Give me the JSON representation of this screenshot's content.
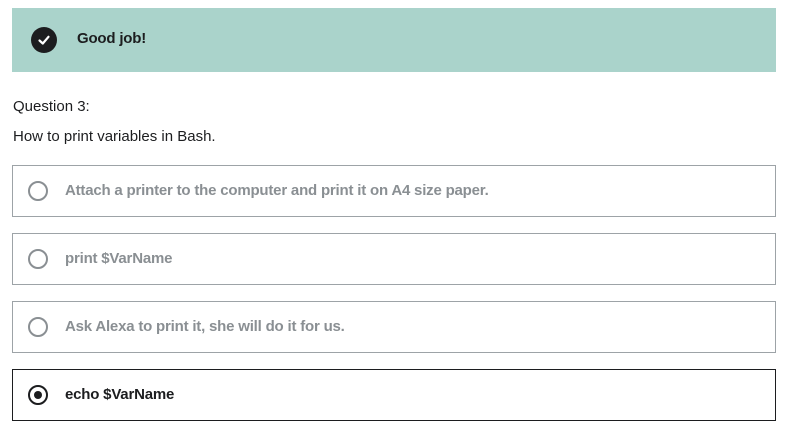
{
  "banner": {
    "icon": "checkmark-icon",
    "message": "Good job!",
    "color": "#aad3cb"
  },
  "question": {
    "number_label": "Question 3:",
    "text": "How to print variables in Bash."
  },
  "options": [
    {
      "label": "Attach a printer to the computer and print it on A4 size paper.",
      "selected": false
    },
    {
      "label": "print $VarName",
      "selected": false
    },
    {
      "label": "Ask Alexa to print it, she will do it for us.",
      "selected": false
    },
    {
      "label": "echo $VarName",
      "selected": true
    }
  ]
}
